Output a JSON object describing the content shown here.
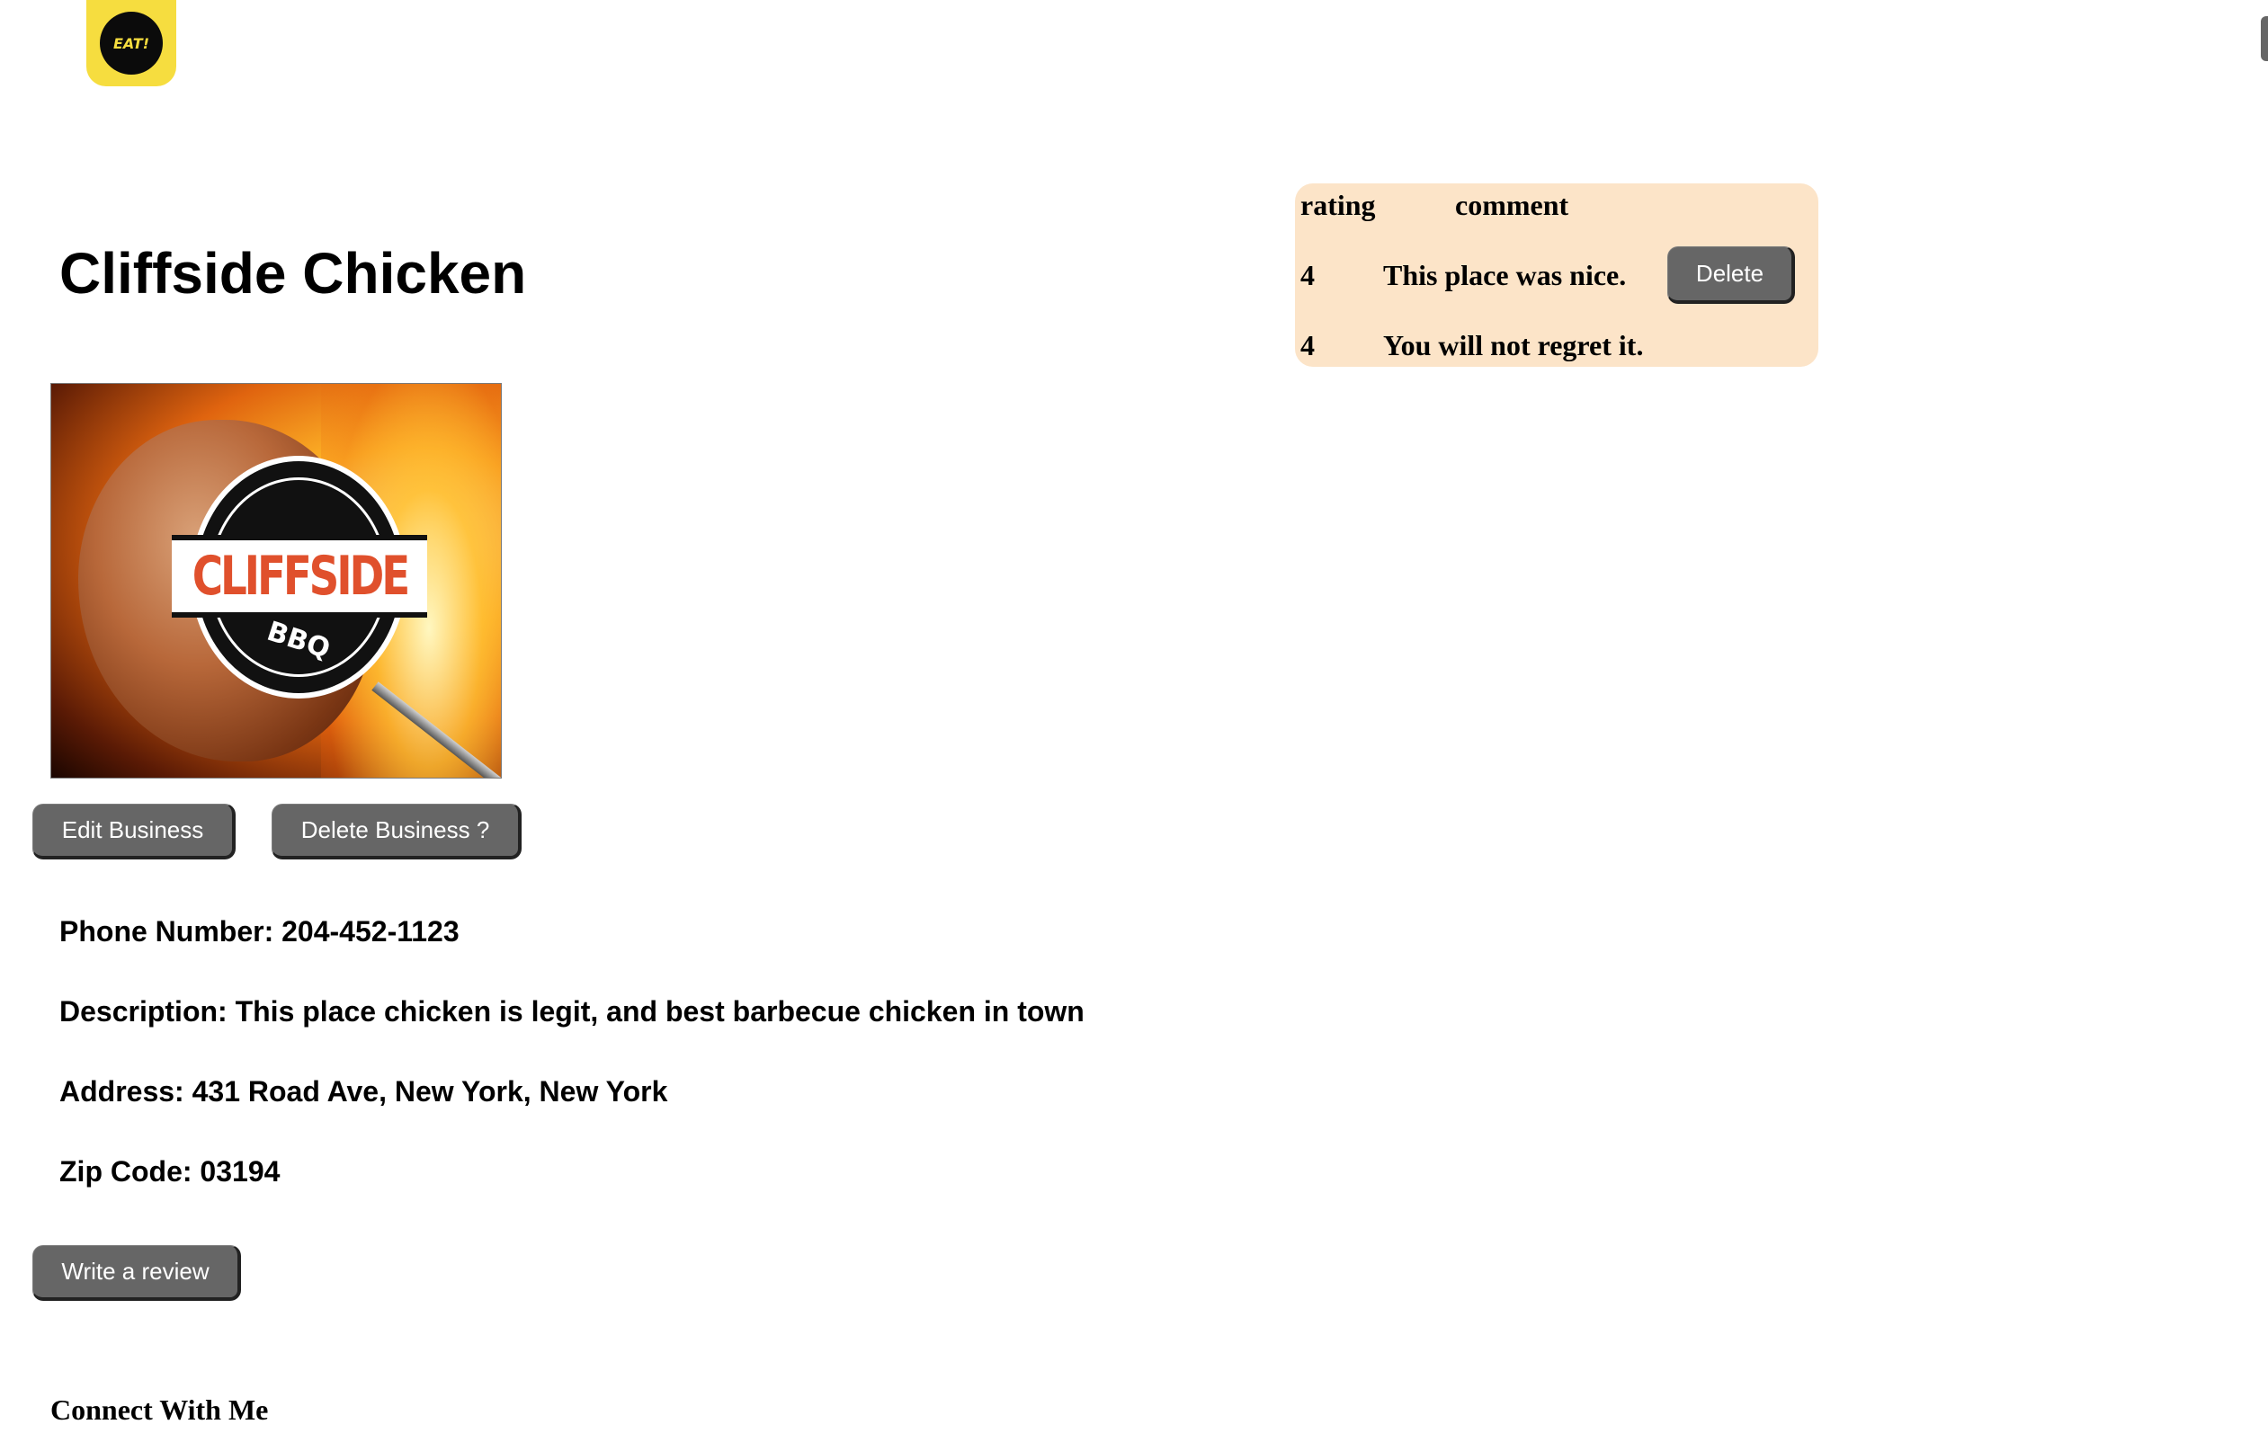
{
  "header": {
    "logo_text": "EAT!"
  },
  "business": {
    "name": "Cliffside Chicken",
    "image_text": "CLIFFSIDE",
    "image_subtext": "BBQ",
    "edit_label": "Edit Business",
    "delete_label": "Delete Business ?",
    "phone_label": "Phone Number:",
    "phone": "204-452-1123",
    "description_label": "Description:",
    "description": "This place chicken is legit, and best barbecue chicken in town",
    "address_label": "Address:",
    "address": "431 Road Ave, New York, New York",
    "zip_label": "Zip Code:",
    "zip": "03194",
    "write_review_label": "Write a review"
  },
  "reviews": {
    "headers": {
      "rating": "rating",
      "comment": "comment"
    },
    "rows": [
      {
        "rating": "4",
        "comment": "This place was nice.",
        "delete_label": "Delete"
      },
      {
        "rating": "4",
        "comment": "You will not regret it."
      }
    ],
    "background": "#fce4c8"
  },
  "footer": {
    "connect_label": "Connect With Me"
  },
  "colors": {
    "button_bg": "#666666",
    "logo_bg": "#f6dd3f"
  }
}
